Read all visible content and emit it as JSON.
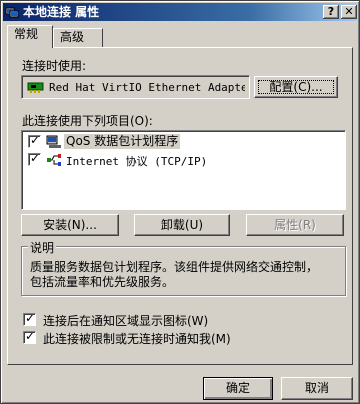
{
  "window": {
    "title": "本地连接 属性",
    "help_label": "?",
    "close_label": "✕"
  },
  "tabs": [
    {
      "label": "常规"
    },
    {
      "label": "高级"
    }
  ],
  "connect_using": {
    "label": "连接时使用:",
    "adapter": "Red Hat VirtIO Ethernet Adapte",
    "configure_label": "配置(C)..."
  },
  "items_section": {
    "label": "此连接使用下列项目(O):",
    "items": [
      {
        "label": "QoS 数据包计划程序",
        "checked": true
      },
      {
        "label": "Internet 协议 (TCP/IP)",
        "checked": true
      }
    ]
  },
  "item_buttons": {
    "install": "安装(N)...",
    "uninstall": "卸载(U)",
    "properties": "属性(R)"
  },
  "description": {
    "title": "说明",
    "line1": "质量服务数据包计划程序。该组件提供网络交通控制，",
    "line2": "包括流量率和优先级服务。"
  },
  "options": [
    {
      "label": "连接后在通知区域显示图标(W)",
      "checked": true
    },
    {
      "label": "此连接被限制或无连接时通知我(M)",
      "checked": true
    }
  ],
  "footer": {
    "ok": "确定",
    "cancel": "取消"
  },
  "check_mark": "✓"
}
